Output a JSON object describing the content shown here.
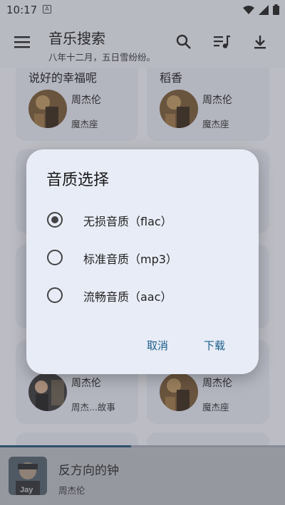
{
  "status_bar": {
    "time": "10:17",
    "notif_badge": "A"
  },
  "app_bar": {
    "title": "音乐搜索",
    "subtitle": "八年十二月，五日雪纷纷。",
    "icons": [
      "menu-icon",
      "search-icon",
      "playlist-icon",
      "download-icon"
    ]
  },
  "results": [
    {
      "song": "说好的幸福呢",
      "artist": "周杰伦",
      "album": "魔杰座"
    },
    {
      "song": "稻香",
      "artist": "周杰伦",
      "album": "魔杰座"
    },
    {
      "song": "",
      "artist": "周杰伦",
      "album": "周杰...故事"
    },
    {
      "song": "",
      "artist": "周杰伦",
      "album": "魔杰座"
    }
  ],
  "dialog": {
    "title": "音质选择",
    "options": [
      {
        "label": "无损音质（flac）",
        "selected": true
      },
      {
        "label": "标准音质（mp3）",
        "selected": false
      },
      {
        "label": "流畅音质（aac）",
        "selected": false
      }
    ],
    "cancel_label": "取消",
    "download_label": "下载"
  },
  "now_playing": {
    "title": "反方向的钟",
    "artist": "周杰伦",
    "cover_text": "Jay",
    "progress": 0.46
  },
  "colors": {
    "accent": "#1a5d8a",
    "background": "#eef1f8",
    "card": "#e6e9f3"
  }
}
